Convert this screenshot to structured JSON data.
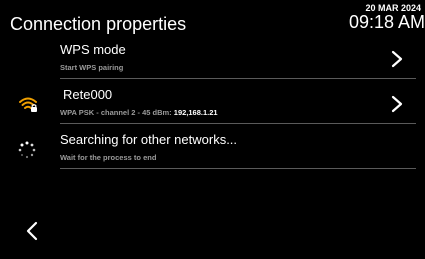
{
  "header": {
    "title": "Connection properties",
    "date": "20 MAR 2024",
    "time": "09:18 AM"
  },
  "rows": [
    {
      "title": "WPS mode",
      "subtitle": "Start WPS pairing",
      "icon": "chevron-right-icon"
    },
    {
      "title": "Rete000",
      "subtitle": "WPA PSK - channel 2 - 45 dBm: ",
      "ip": "192,168.1.21",
      "icon": "wifi-locked-icon",
      "icon_color": "#f0a000"
    },
    {
      "title": "Searching for other networks...",
      "subtitle": "Wait for the process to end",
      "icon": "loading-spinner-icon"
    }
  ],
  "footer": {
    "back_icon": "chevron-left-icon"
  },
  "colors": {
    "background": "#000000",
    "divider": "#5a5a5a",
    "accent": "#f0a000",
    "subtitle": "#9a9a9a"
  }
}
